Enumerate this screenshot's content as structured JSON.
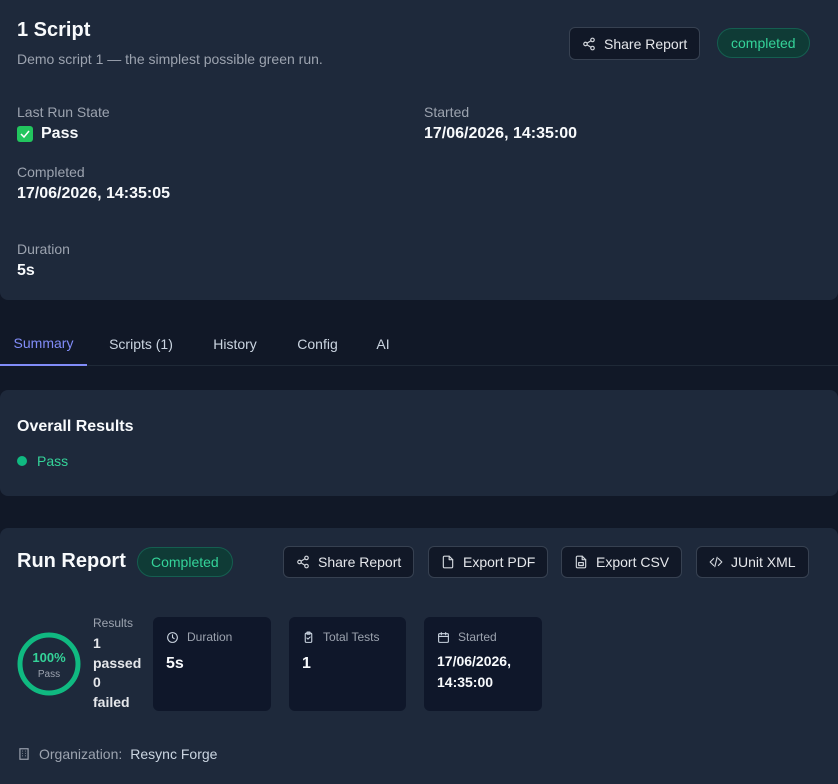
{
  "header": {
    "title": "1 Script",
    "subtitle": "Demo script 1 — the simplest possible green run.",
    "share_label": "Share Report",
    "status_badge": "completed",
    "last_run_state_label": "Last Run State",
    "last_run_state_value": "Pass",
    "started_label": "Started",
    "started_value": "17/06/2026, 14:35:00",
    "completed_label": "Completed",
    "completed_value": "17/06/2026, 14:35:05",
    "duration_label": "Duration",
    "duration_value": "5s"
  },
  "tabs": [
    {
      "label": "Summary",
      "active": true
    },
    {
      "label": "Scripts (1)",
      "active": false
    },
    {
      "label": "History",
      "active": false
    },
    {
      "label": "Config",
      "active": false
    },
    {
      "label": "AI",
      "active": false
    }
  ],
  "overall": {
    "title": "Overall Results",
    "status": "Pass"
  },
  "report": {
    "title": "Run Report",
    "badge": "Completed",
    "buttons": {
      "share": "Share Report",
      "pdf": "Export PDF",
      "csv": "Export CSV",
      "junit": "JUnit XML"
    },
    "ring": {
      "percent_text": "100%",
      "sub": "Pass",
      "fraction": 1.0
    },
    "results_label": "Results",
    "passed_count": "1",
    "passed_word": "passed",
    "failed_count": "0",
    "failed_word": "failed",
    "stats": {
      "duration_label": "Duration",
      "duration_value": "5s",
      "total_label": "Total Tests",
      "total_value": "1",
      "started_label": "Started",
      "started_line1": "17/06/2026,",
      "started_line2": "14:35:00"
    },
    "org_label": "Organization:",
    "org_value": "Resync Forge"
  },
  "colors": {
    "accent": "#818cf8",
    "success": "#34d399",
    "card": "#1e293b",
    "background": "#111827"
  }
}
